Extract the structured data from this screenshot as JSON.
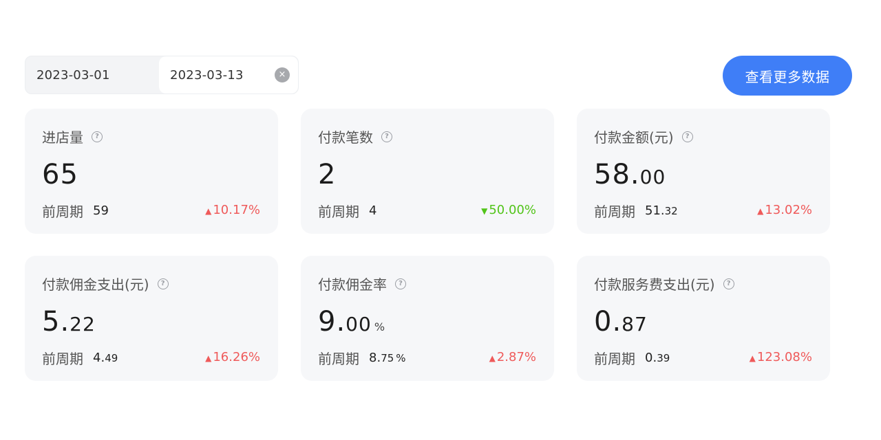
{
  "date_range": {
    "start": "2023-03-01",
    "end": "2023-03-13",
    "clear_icon": "×"
  },
  "more_button": "查看更多数据",
  "prev_label": "前周期",
  "help_icon": "?",
  "colors": {
    "accent": "#3f7ef7",
    "up": "#ef5a5a",
    "down": "#52c41a",
    "card_bg": "#f6f7f9"
  },
  "cards": [
    {
      "title": "进店量",
      "value_int": "65",
      "value_dec": "",
      "value_unit": "",
      "prev_int": "59",
      "prev_dec": "",
      "prev_unit": "",
      "change": "10.17%",
      "direction": "up",
      "arrow": "▲"
    },
    {
      "title": "付款笔数",
      "value_int": "2",
      "value_dec": "",
      "value_unit": "",
      "prev_int": "4",
      "prev_dec": "",
      "prev_unit": "",
      "change": "50.00%",
      "direction": "down",
      "arrow": "▼"
    },
    {
      "title": "付款金额(元)",
      "value_int": "58.",
      "value_dec": "00",
      "value_unit": "",
      "prev_int": "51.",
      "prev_dec": "32",
      "prev_unit": "",
      "change": "13.02%",
      "direction": "up",
      "arrow": "▲"
    },
    {
      "title": "付款佣金支出(元)",
      "value_int": "5.",
      "value_dec": "22",
      "value_unit": "",
      "prev_int": "4.",
      "prev_dec": "49",
      "prev_unit": "",
      "change": "16.26%",
      "direction": "up",
      "arrow": "▲"
    },
    {
      "title": "付款佣金率",
      "value_int": "9.",
      "value_dec": "00",
      "value_unit": "%",
      "prev_int": "8.",
      "prev_dec": "75",
      "prev_unit": "%",
      "change": "2.87%",
      "direction": "up",
      "arrow": "▲"
    },
    {
      "title": "付款服务费支出(元)",
      "value_int": "0.",
      "value_dec": "87",
      "value_unit": "",
      "prev_int": "0.",
      "prev_dec": "39",
      "prev_unit": "",
      "change": "123.08%",
      "direction": "up",
      "arrow": "▲"
    }
  ]
}
